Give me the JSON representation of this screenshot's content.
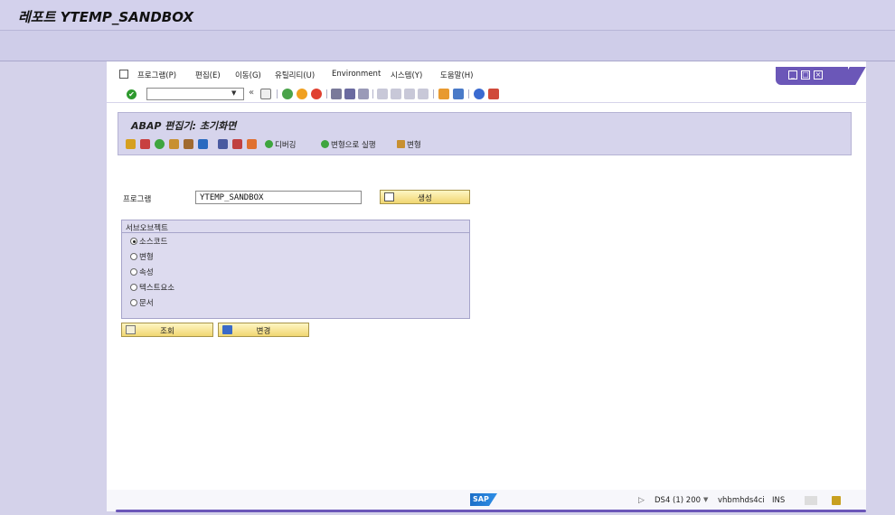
{
  "window": {
    "title": "레포트 YTEMP_SANDBOX"
  },
  "menubar": {
    "items": [
      "프로그램(P)",
      "편집(E)",
      "이동(G)",
      "유틸리티(U)",
      "Environment",
      "시스템(Y)",
      "도움말(H)"
    ]
  },
  "window_controls": {
    "minimize": "_",
    "maximize": "□",
    "close": "×"
  },
  "toolbar": {
    "command_field_value": "",
    "back_glyph": "«",
    "check_glyph": "✔",
    "icons": [
      "enter-icon",
      "save-icon",
      "back-icon",
      "exit-icon",
      "cancel-icon",
      "print-icon",
      "find-icon",
      "find-next-icon",
      "first-page-icon",
      "prev-page-icon",
      "next-page-icon",
      "last-page-icon",
      "create-session-icon",
      "shortcut-icon",
      "help-icon",
      "customize-layout-icon"
    ]
  },
  "screen": {
    "title": "ABAP 편집기: 초기화면",
    "app_toolbar": {
      "debug_label": "디버깅",
      "run_variant_label": "변형으로 실행",
      "variant_label": "변형"
    }
  },
  "program_field": {
    "label": "프로그램",
    "value": "YTEMP_SANDBOX"
  },
  "buttons": {
    "create": "생성",
    "display": "조회",
    "change": "변경"
  },
  "subobjects": {
    "title": "서브오브젝트",
    "options": [
      {
        "label": "소스코드",
        "selected": true
      },
      {
        "label": "변형",
        "selected": false
      },
      {
        "label": "속성",
        "selected": false
      },
      {
        "label": "텍스트요소",
        "selected": false
      },
      {
        "label": "문서",
        "selected": false
      }
    ]
  },
  "status": {
    "system": "DS4 (1) 200",
    "server": "vhbmhds4ci",
    "mode": "INS",
    "logo": "SAP",
    "dropdown_glyph": "▼",
    "play_glyph": "▷"
  },
  "colors": {
    "accent": "#6b57b8",
    "button": "#f3db7a",
    "header": "#d6d4ec"
  }
}
